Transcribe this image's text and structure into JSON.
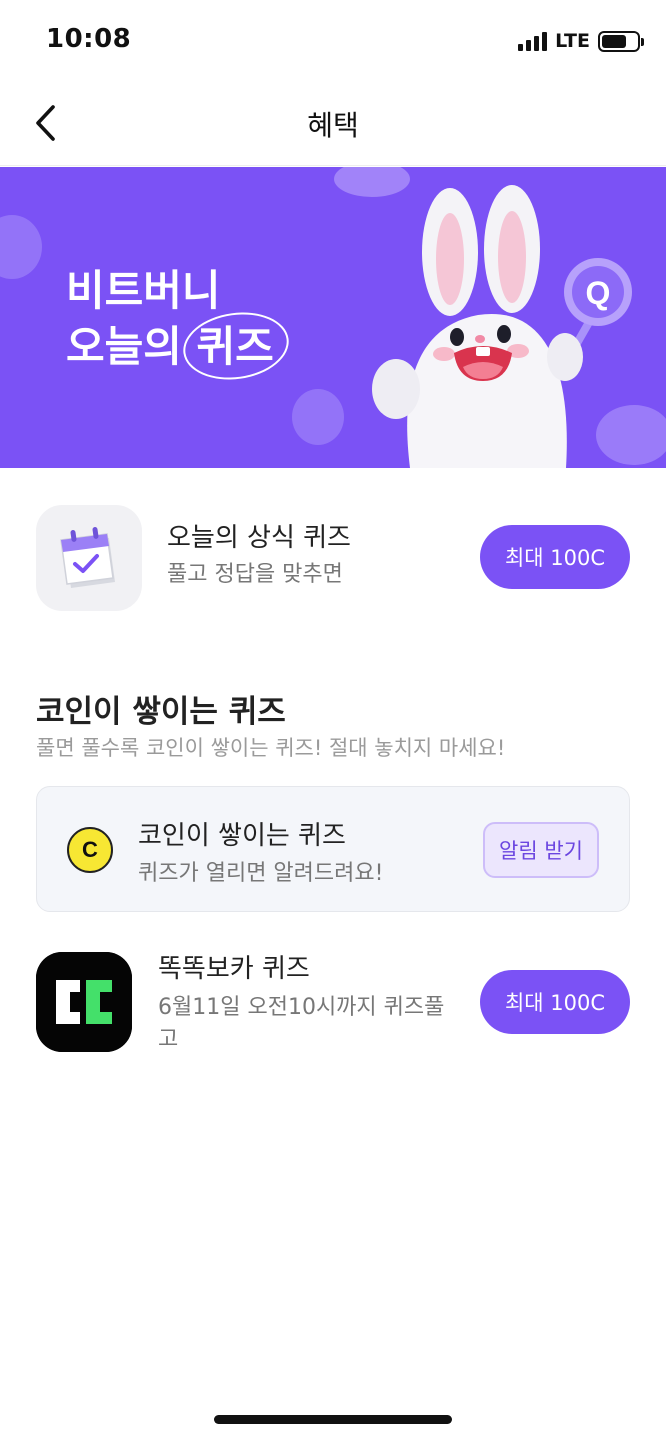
{
  "status_bar": {
    "time": "10:08",
    "network": "LTE"
  },
  "header": {
    "title": "혜택"
  },
  "banner": {
    "title_line1": "비트버니",
    "title_line2": "오늘의 퀴즈"
  },
  "daily_quiz": {
    "title": "오늘의 상식 퀴즈",
    "subtitle": "풀고 정답을 맞추면",
    "reward_label": "최대 100C"
  },
  "coin_section": {
    "title": "코인이 쌓이는 퀴즈",
    "description": "풀면 풀수록 코인이 쌓이는 퀴즈! 절대 놓치지 마세요!",
    "card": {
      "icon_letter": "C",
      "title": "코인이 쌓이는 퀴즈",
      "subtitle": "퀴즈가 열리면 알려드려요!",
      "button_label": "알림 받기"
    }
  },
  "partner_quiz": {
    "title": "똑똑보카 퀴즈",
    "subtitle_line1": "6월11일 오전10시까지 퀴즈풀",
    "subtitle_line2": "고",
    "reward_label": "최대 100C"
  },
  "colors": {
    "accent": "#7b52f5",
    "coin_yellow": "#f7e733",
    "app_green": "#44e06a"
  }
}
